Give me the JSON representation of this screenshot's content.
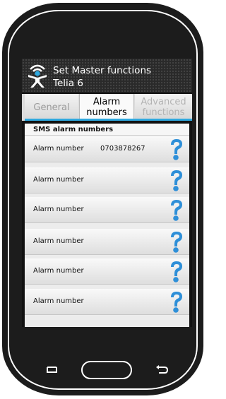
{
  "header": {
    "title": "Set Master functions",
    "subtitle": "Telia 6",
    "logo_icon": "person-wifi-icon"
  },
  "tabs": [
    {
      "label_line1": "General",
      "label_line2": "",
      "state": "inactive"
    },
    {
      "label_line1": "Alarm",
      "label_line2": "numbers",
      "state": "active"
    },
    {
      "label_line1": "Advanced",
      "label_line2": "functions",
      "state": "disabled"
    }
  ],
  "section": {
    "title": "SMS alarm numbers"
  },
  "alarm_rows": [
    {
      "label": "Alarm number",
      "value": "0703878267",
      "icon": "help-question-icon"
    },
    {
      "label": "Alarm number",
      "value": "",
      "icon": "help-question-icon"
    },
    {
      "label": "Alarm number",
      "value": "",
      "icon": "help-question-icon"
    },
    {
      "label": "Alarm number",
      "value": "",
      "icon": "help-question-icon"
    },
    {
      "label": "Alarm number",
      "value": "",
      "icon": "help-question-icon"
    },
    {
      "label": "Alarm number",
      "value": "",
      "icon": "help-question-icon"
    }
  ],
  "colors": {
    "accent": "#2fa9e0",
    "help_icon": "#2e8fd8",
    "titlebar": "#2a2a2a"
  }
}
